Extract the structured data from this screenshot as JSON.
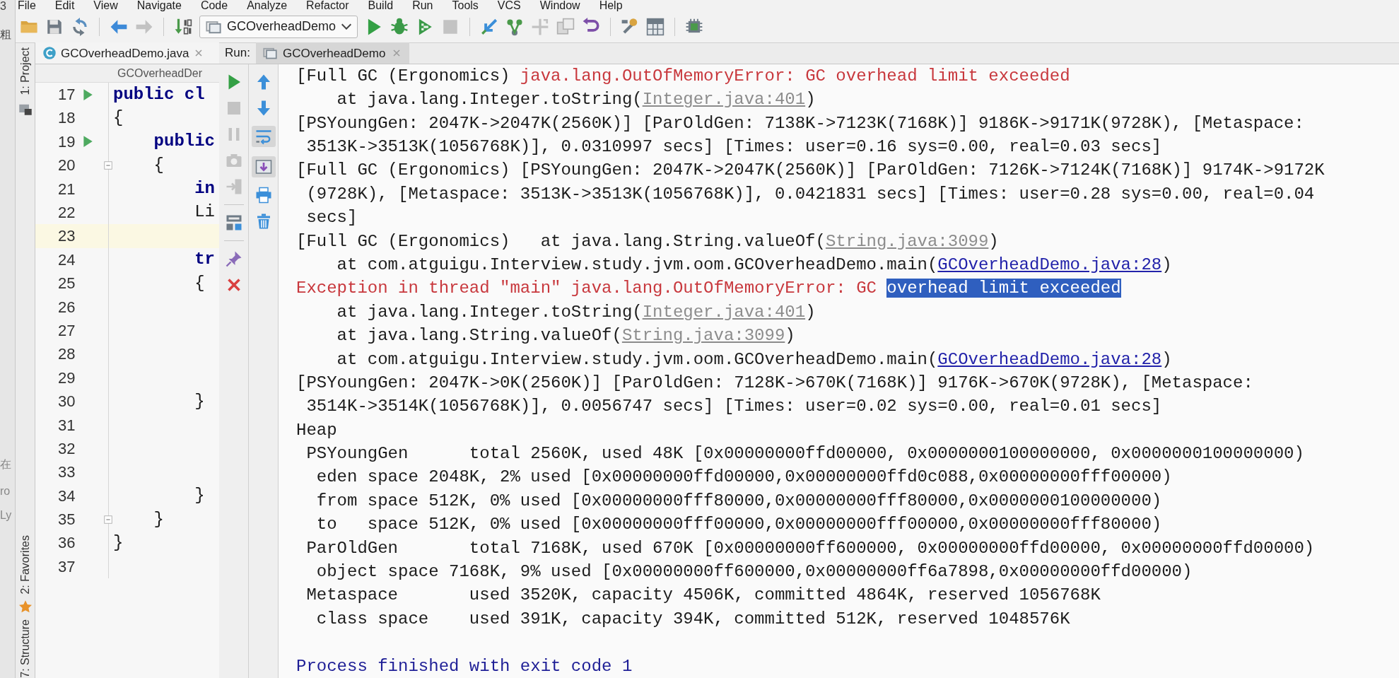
{
  "menu": [
    "File",
    "Edit",
    "View",
    "Navigate",
    "Code",
    "Analyze",
    "Refactor",
    "Build",
    "Run",
    "Tools",
    "VCS",
    "Window",
    "Help"
  ],
  "toolbar": {
    "run_configuration": "GCOverheadDemo"
  },
  "background_fragments": [
    "3",
    "粗",
    "在",
    "ro",
    "Ly"
  ],
  "tool_strip": [
    {
      "label": "1: Project"
    },
    {
      "label": "2: Favorites"
    },
    {
      "label": "7: Structure"
    }
  ],
  "editor": {
    "tab": "GCOverheadDemo.java",
    "breadcrumb": "GCOverheadDer",
    "lines": [
      {
        "number": "17",
        "code": "public cl",
        "kind": "keyword",
        "run_icon": true,
        "fold": false,
        "current": false
      },
      {
        "number": "18",
        "code": "{",
        "kind": "plain",
        "run_icon": false,
        "fold": false,
        "current": false
      },
      {
        "number": "19",
        "code": "    public",
        "kind": "keyword",
        "run_icon": true,
        "fold": false,
        "current": false
      },
      {
        "number": "20",
        "code": "    {",
        "kind": "plain",
        "run_icon": false,
        "fold": true,
        "current": false
      },
      {
        "number": "21",
        "code": "        in",
        "kind": "keyword",
        "run_icon": false,
        "fold": false,
        "current": false
      },
      {
        "number": "22",
        "code": "        Li",
        "kind": "plain",
        "run_icon": false,
        "fold": false,
        "current": false
      },
      {
        "number": "23",
        "run_icon": false,
        "fold": false,
        "current": true
      },
      {
        "number": "24",
        "code": "        tr",
        "kind": "keyword",
        "run_icon": false,
        "fold": false,
        "current": false
      },
      {
        "number": "25",
        "code": "        {",
        "kind": "plain",
        "run_icon": false,
        "fold": false,
        "current": false
      },
      {
        "number": "26",
        "run_icon": false,
        "fold": false,
        "current": false
      },
      {
        "number": "27",
        "run_icon": false,
        "fold": false,
        "current": false
      },
      {
        "number": "28",
        "run_icon": false,
        "fold": false,
        "current": false
      },
      {
        "number": "29",
        "run_icon": false,
        "fold": false,
        "current": false
      },
      {
        "number": "30",
        "code": "        }",
        "kind": "plain",
        "run_icon": false,
        "fold": false,
        "current": false
      },
      {
        "number": "31",
        "run_icon": false,
        "fold": false,
        "current": false
      },
      {
        "number": "32",
        "run_icon": false,
        "fold": false,
        "current": false
      },
      {
        "number": "33",
        "run_icon": false,
        "fold": false,
        "current": false
      },
      {
        "number": "34",
        "code": "        }",
        "kind": "plain",
        "run_icon": false,
        "fold": false,
        "current": false
      },
      {
        "number": "35",
        "code": "    }",
        "kind": "plain",
        "run_icon": false,
        "fold": true,
        "current": false
      },
      {
        "number": "36",
        "code": "}",
        "kind": "plain",
        "run_icon": false,
        "fold": false,
        "current": false
      },
      {
        "number": "37",
        "run_icon": false,
        "fold": false,
        "current": false
      }
    ]
  },
  "run": {
    "label": "Run:",
    "tab": "GCOverheadDemo",
    "soft_wrap": true,
    "scroll_to_end": true,
    "console": [
      {
        "kind": "line",
        "segments": [
          {
            "text": "[Full GC (Ergonomics) ",
            "kind": "plain"
          },
          {
            "text": "java.lang.OutOfMemoryError: GC overhead limit exceeded",
            "kind": "error"
          }
        ]
      },
      {
        "kind": "line",
        "segments": [
          {
            "text": "    at java.lang.Integer.toString(",
            "kind": "plain"
          },
          {
            "text": "Integer.java:401",
            "kind": "library-link"
          },
          {
            "text": ")",
            "kind": "plain"
          }
        ]
      },
      {
        "kind": "line",
        "segments": [
          {
            "text": "[PSYoungGen: 2047K->2047K(2560K)] [ParOldGen: 7138K->7123K(7168K)] 9186K->9171K(9728K), [Metaspace:",
            "kind": "plain"
          }
        ]
      },
      {
        "kind": "line",
        "segments": [
          {
            "text": " 3513K->3513K(1056768K)], 0.0310997 secs] [Times: user=0.16 sys=0.00, real=0.03 secs]",
            "kind": "plain"
          }
        ]
      },
      {
        "kind": "line",
        "segments": [
          {
            "text": "[Full GC (Ergonomics) [PSYoungGen: 2047K->2047K(2560K)] [ParOldGen: 7126K->7124K(7168K)] 9174K->9172K",
            "kind": "plain"
          }
        ]
      },
      {
        "kind": "line",
        "segments": [
          {
            "text": " (9728K), [Metaspace: 3513K->3513K(1056768K)], 0.0421831 secs] [Times: user=0.28 sys=0.00, real=0.04",
            "kind": "plain"
          }
        ]
      },
      {
        "kind": "line",
        "segments": [
          {
            "text": " secs]",
            "kind": "plain"
          }
        ]
      },
      {
        "kind": "line",
        "segments": [
          {
            "text": "[Full GC (Ergonomics)   at java.lang.String.valueOf(",
            "kind": "plain"
          },
          {
            "text": "String.java:3099",
            "kind": "library-link"
          },
          {
            "text": ")",
            "kind": "plain"
          }
        ]
      },
      {
        "kind": "line",
        "segments": [
          {
            "text": "    at com.atguigu.Interview.study.jvm.oom.GCOverheadDemo.main(",
            "kind": "plain"
          },
          {
            "text": "GCOverheadDemo.java:28",
            "kind": "link"
          },
          {
            "text": ")",
            "kind": "plain"
          }
        ]
      },
      {
        "kind": "line",
        "segments": [
          {
            "text": "Exception in thread \"main\" java.lang.OutOfMemoryError: GC ",
            "kind": "error"
          },
          {
            "text": "overhead limit exceeded",
            "kind": "selection"
          }
        ]
      },
      {
        "kind": "line",
        "segments": [
          {
            "text": "    at java.lang.Integer.toString(",
            "kind": "plain"
          },
          {
            "text": "Integer.java:401",
            "kind": "library-link"
          },
          {
            "text": ")",
            "kind": "plain"
          }
        ]
      },
      {
        "kind": "line",
        "segments": [
          {
            "text": "    at java.lang.String.valueOf(",
            "kind": "plain"
          },
          {
            "text": "String.java:3099",
            "kind": "library-link"
          },
          {
            "text": ")",
            "kind": "plain"
          }
        ]
      },
      {
        "kind": "line",
        "segments": [
          {
            "text": "    at com.atguigu.Interview.study.jvm.oom.GCOverheadDemo.main(",
            "kind": "plain"
          },
          {
            "text": "GCOverheadDemo.java:28",
            "kind": "link"
          },
          {
            "text": ")",
            "kind": "plain"
          }
        ]
      },
      {
        "kind": "line",
        "segments": [
          {
            "text": "[PSYoungGen: 2047K->0K(2560K)] [ParOldGen: 7128K->670K(7168K)] 9176K->670K(9728K), [Metaspace:",
            "kind": "plain"
          }
        ]
      },
      {
        "kind": "line",
        "segments": [
          {
            "text": " 3514K->3514K(1056768K)], 0.0056747 secs] [Times: user=0.02 sys=0.00, real=0.01 secs]",
            "kind": "plain"
          }
        ]
      },
      {
        "kind": "line",
        "segments": [
          {
            "text": "Heap",
            "kind": "plain"
          }
        ]
      },
      {
        "kind": "line",
        "segments": [
          {
            "text": " PSYoungGen      total 2560K, used 48K [0x00000000ffd00000, 0x0000000100000000, 0x0000000100000000)",
            "kind": "plain"
          }
        ]
      },
      {
        "kind": "line",
        "segments": [
          {
            "text": "  eden space 2048K, 2% used [0x00000000ffd00000,0x00000000ffd0c088,0x00000000fff00000)",
            "kind": "plain"
          }
        ]
      },
      {
        "kind": "line",
        "segments": [
          {
            "text": "  from space 512K, 0% used [0x00000000fff80000,0x00000000fff80000,0x0000000100000000)",
            "kind": "plain"
          }
        ]
      },
      {
        "kind": "line",
        "segments": [
          {
            "text": "  to   space 512K, 0% used [0x00000000fff00000,0x00000000fff00000,0x00000000fff80000)",
            "kind": "plain"
          }
        ]
      },
      {
        "kind": "line",
        "segments": [
          {
            "text": " ParOldGen       total 7168K, used 670K [0x00000000ff600000, 0x00000000ffd00000, 0x00000000ffd00000)",
            "kind": "plain"
          }
        ]
      },
      {
        "kind": "line",
        "segments": [
          {
            "text": "  object space 7168K, 9% used [0x00000000ff600000,0x00000000ff6a7898,0x00000000ffd00000)",
            "kind": "plain"
          }
        ]
      },
      {
        "kind": "line",
        "segments": [
          {
            "text": " Metaspace       used 3520K, capacity 4506K, committed 4864K, reserved 1056768K",
            "kind": "plain"
          }
        ]
      },
      {
        "kind": "line",
        "segments": [
          {
            "text": "  class space    used 391K, capacity 394K, committed 512K, reserved 1048576K",
            "kind": "plain"
          }
        ]
      },
      {
        "kind": "blank"
      },
      {
        "kind": "line",
        "segments": [
          {
            "text": "Process finished with exit code 1",
            "kind": "exit"
          }
        ]
      }
    ]
  }
}
